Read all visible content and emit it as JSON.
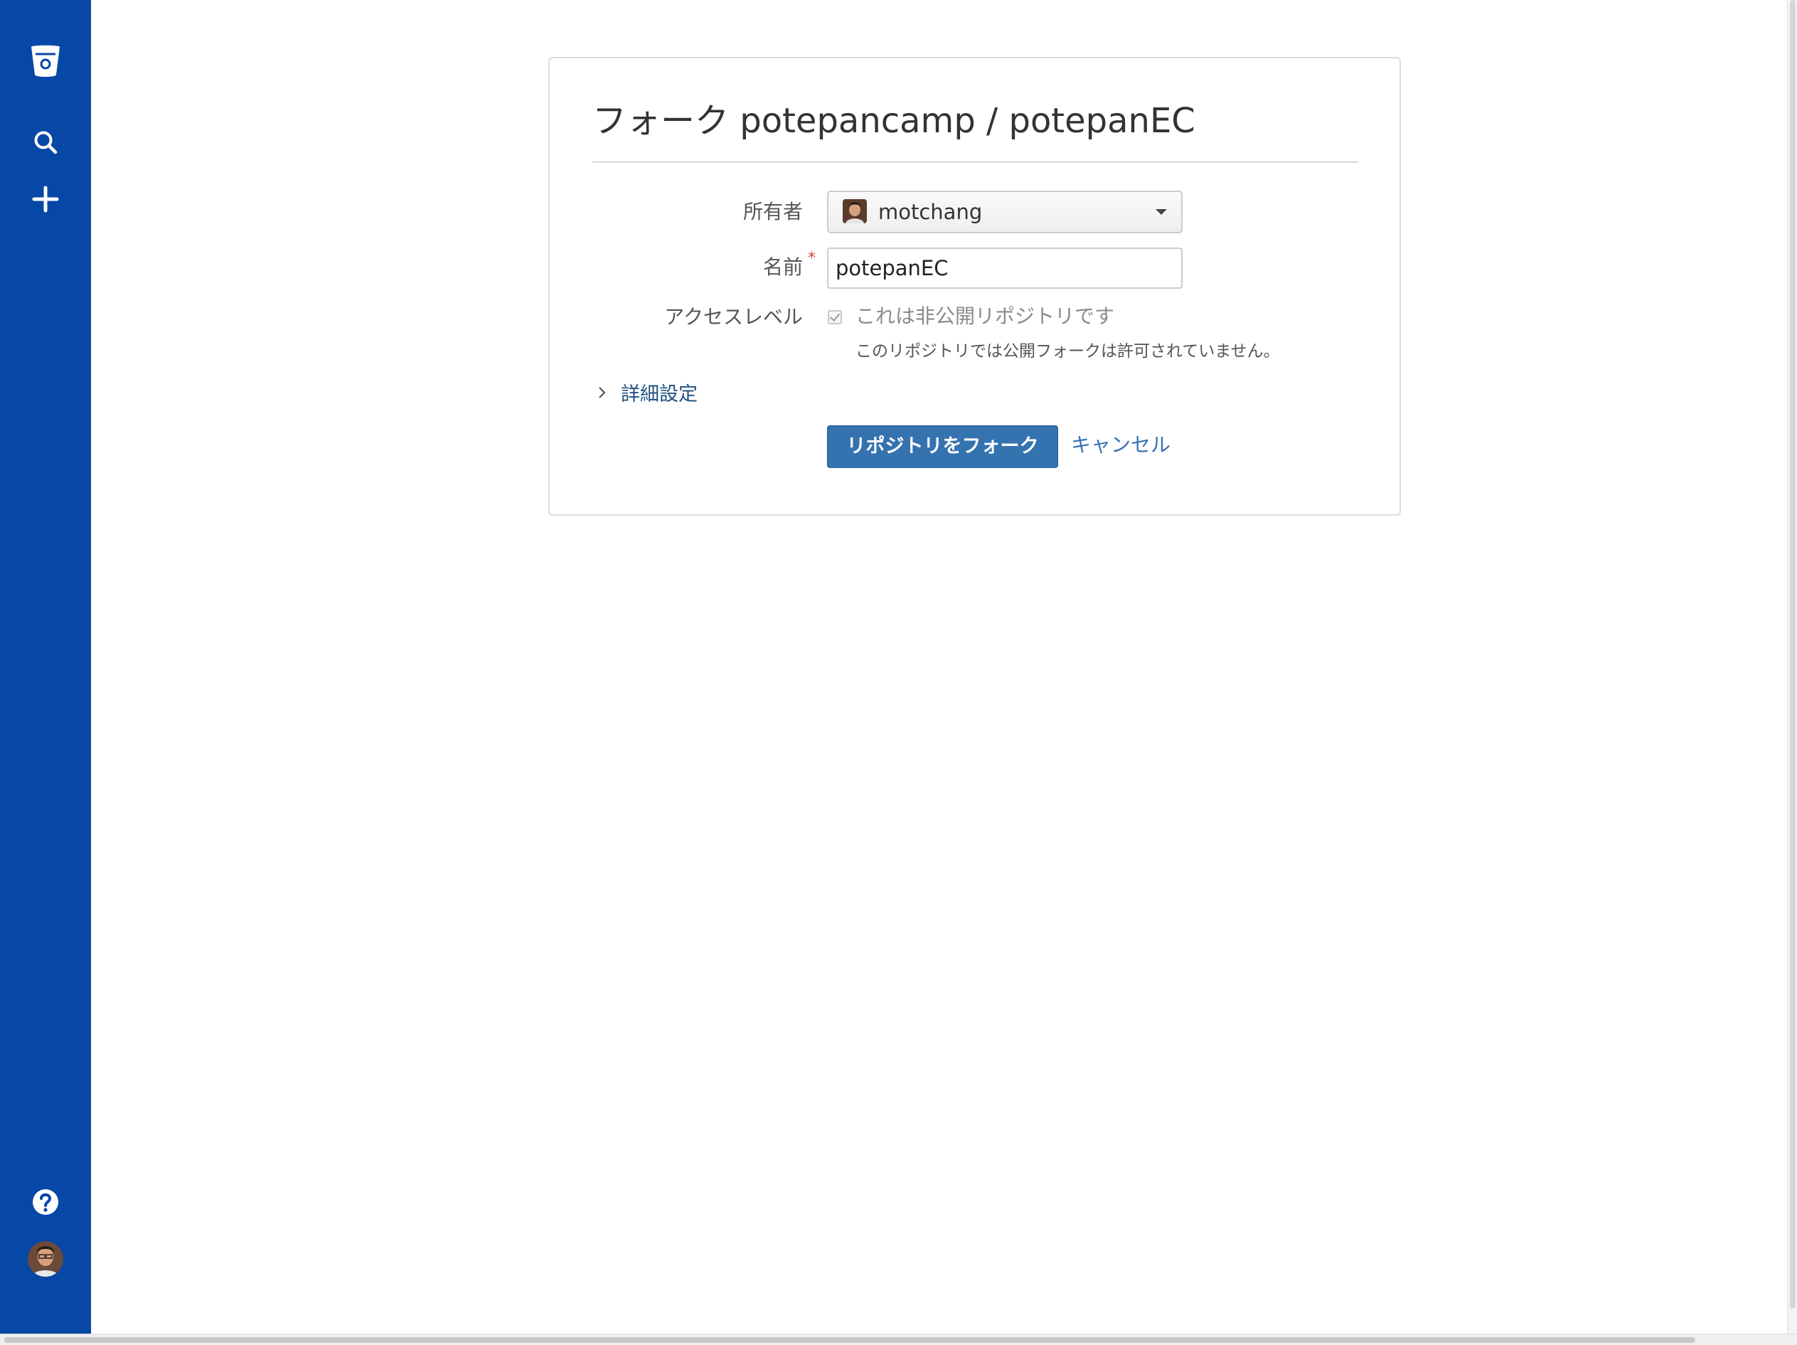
{
  "page": {
    "title": "フォーク potepancamp / potepanEC"
  },
  "sidebar": {
    "logo_icon": "bitbucket-logo-icon",
    "items": [
      {
        "icon": "search-icon"
      },
      {
        "icon": "plus-icon"
      },
      {
        "icon": "help-icon"
      },
      {
        "icon": "user-avatar"
      }
    ]
  },
  "form": {
    "owner": {
      "label": "所有者",
      "value": "motchang",
      "avatar_icon": "user-avatar"
    },
    "name": {
      "label": "名前",
      "required_marker": "*",
      "value": "potepanEC"
    },
    "access": {
      "label": "アクセスレベル",
      "checkbox_label": "これは非公開リポジトリです",
      "checked": true,
      "note": "このリポジトリでは公開フォークは許可されていません。"
    },
    "advanced": {
      "label": "詳細設定"
    },
    "actions": {
      "fork_label": "リポジトリをフォーク",
      "cancel_label": "キャンセル"
    }
  },
  "colors": {
    "sidebar": "#0747a6",
    "primary_button": "#3572b0",
    "link": "#205081",
    "required": "#d04437"
  }
}
